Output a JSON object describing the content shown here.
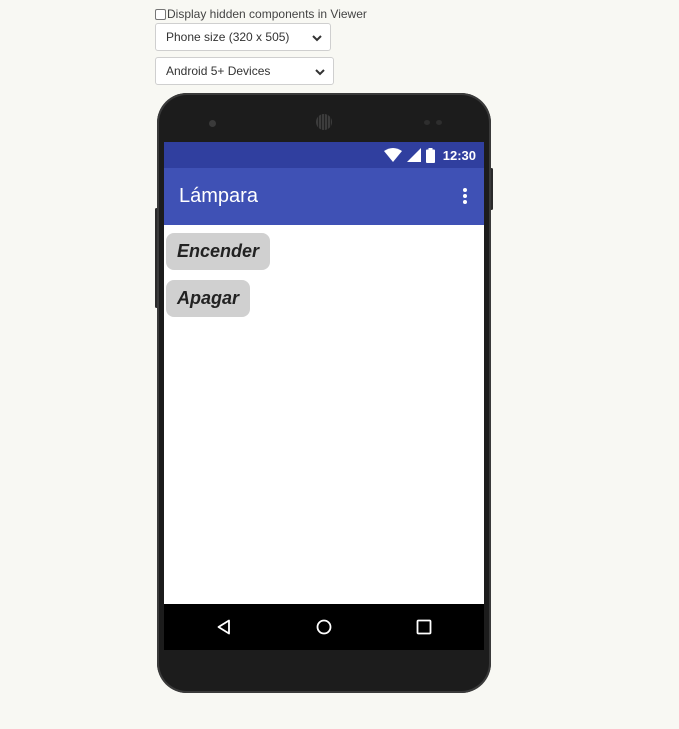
{
  "viewer": {
    "hidden_components_label": "Display hidden components in Viewer",
    "hidden_components_checked": false,
    "phone_size": "Phone size (320 x 505)",
    "device_type": "Android 5+ Devices"
  },
  "status_bar": {
    "time": "12:30",
    "color": "#303f9f"
  },
  "app_bar": {
    "title": "Lámpara",
    "color": "#3f51b5"
  },
  "buttons": {
    "on_label": "Encender",
    "off_label": "Apagar"
  },
  "nav_bar": {
    "icons": [
      "back-icon",
      "home-icon",
      "recents-icon"
    ]
  }
}
